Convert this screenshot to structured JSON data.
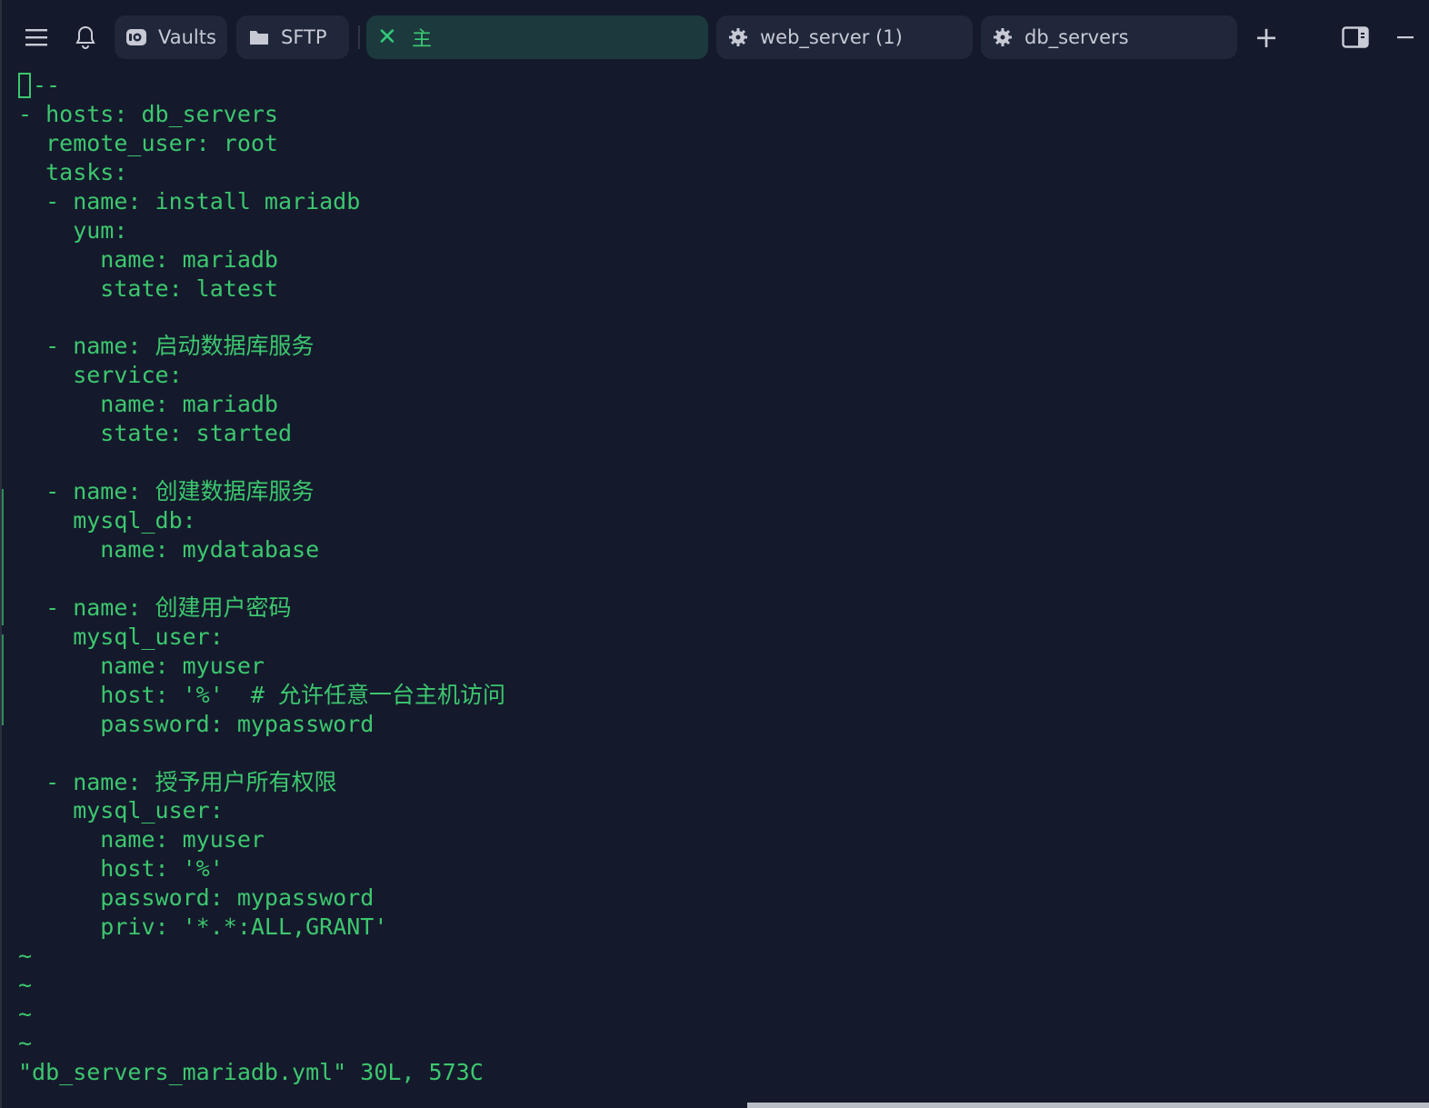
{
  "topbar": {
    "tabs": [
      {
        "label": "Vaults",
        "icon": "vault-icon"
      },
      {
        "label": "SFTP",
        "icon": "folder-icon"
      },
      {
        "label": "主",
        "icon": "close-icon",
        "active": true
      },
      {
        "label": "web_server (1)",
        "icon": "gear-icon"
      },
      {
        "label": "db_servers",
        "icon": "gear-icon"
      }
    ],
    "new_tab": "+",
    "colors": {
      "accent": "#3cc973",
      "active_tab_bg": "#1c3a3d",
      "tab_bg": "#20273a",
      "bg": "#141a2c"
    }
  },
  "terminal": {
    "text_color": "#3dc76e",
    "lines": [
      "--",
      "- hosts: db_servers",
      "  remote_user: root",
      "  tasks:",
      "  - name: install mariadb",
      "    yum:",
      "      name: mariadb",
      "      state: latest",
      "",
      "  - name: 启动数据库服务",
      "    service:",
      "      name: mariadb",
      "      state: started",
      "",
      "  - name: 创建数据库服务",
      "    mysql_db:",
      "      name: mydatabase",
      "",
      "  - name: 创建用户密码",
      "    mysql_user:",
      "      name: myuser",
      "      host: '%'  # 允许任意一台主机访问",
      "      password: mypassword",
      "",
      "  - name: 授予用户所有权限",
      "    mysql_user:",
      "      name: myuser",
      "      host: '%'",
      "      password: mypassword",
      "      priv: '*.*:ALL,GRANT'",
      "~",
      "~",
      "~",
      "~",
      "\"db_servers_mariadb.yml\" 30L, 573C"
    ]
  }
}
